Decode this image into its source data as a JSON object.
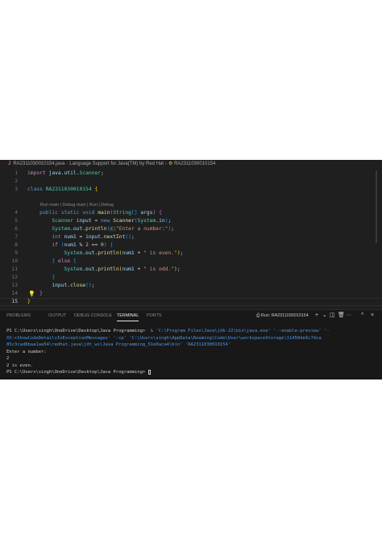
{
  "breadcrumb": {
    "file_icon": "J",
    "file": "RA2311030010154.java",
    "item2": "Language Support for Java(TM) by Red Hat",
    "class_icon": "class-icon",
    "item3": "RA2311030010154"
  },
  "code_lens": "Run main | Debug main | Run | Debug",
  "line_numbers": [
    "1",
    "2",
    "3",
    "4",
    "5",
    "6",
    "7",
    "8",
    "9",
    "10",
    "11",
    "12",
    "13",
    "14",
    "15"
  ],
  "panel": {
    "tabs": [
      "PROBLEMS",
      "OUTPUT",
      "DEBUG CONSOLE",
      "TERMINAL",
      "PORTS"
    ],
    "active_tab": "TERMINAL",
    "run_label": "Run: RA2311030010154"
  },
  "terminal": {
    "prompt1": "PS C:\\Users\\singh\\OneDrive\\Desktop\\Java Programming> ",
    "cmd1": " & 'C:\\Program Files\\Java\\jdk-22\\bin\\java.exe' '--enable-preview' '-",
    "cmd2": "XX:+ShowCodeDetailsInExceptionMessages' '-cp' 'C:\\Users\\singh\\AppData\\Roaming\\Code\\User\\workspaceStorage\\11450de6c74ca",
    "cmd3": "85c3cad8baa1aa54\\redhat.java\\jdt_ws\\Java Programming_51e0aca4\\bin' 'RA2311030010154'",
    "out1": "Enter a number:",
    "out2": "2",
    "out3": "2 is even.",
    "prompt2": "PS C:\\Users\\singh\\OneDrive\\Desktop\\Java Programming> "
  },
  "colors": {
    "editor_bg": "#1f1f1f",
    "panel_bg": "#181818",
    "keyword": "#569cd6",
    "string": "#ce9178"
  }
}
